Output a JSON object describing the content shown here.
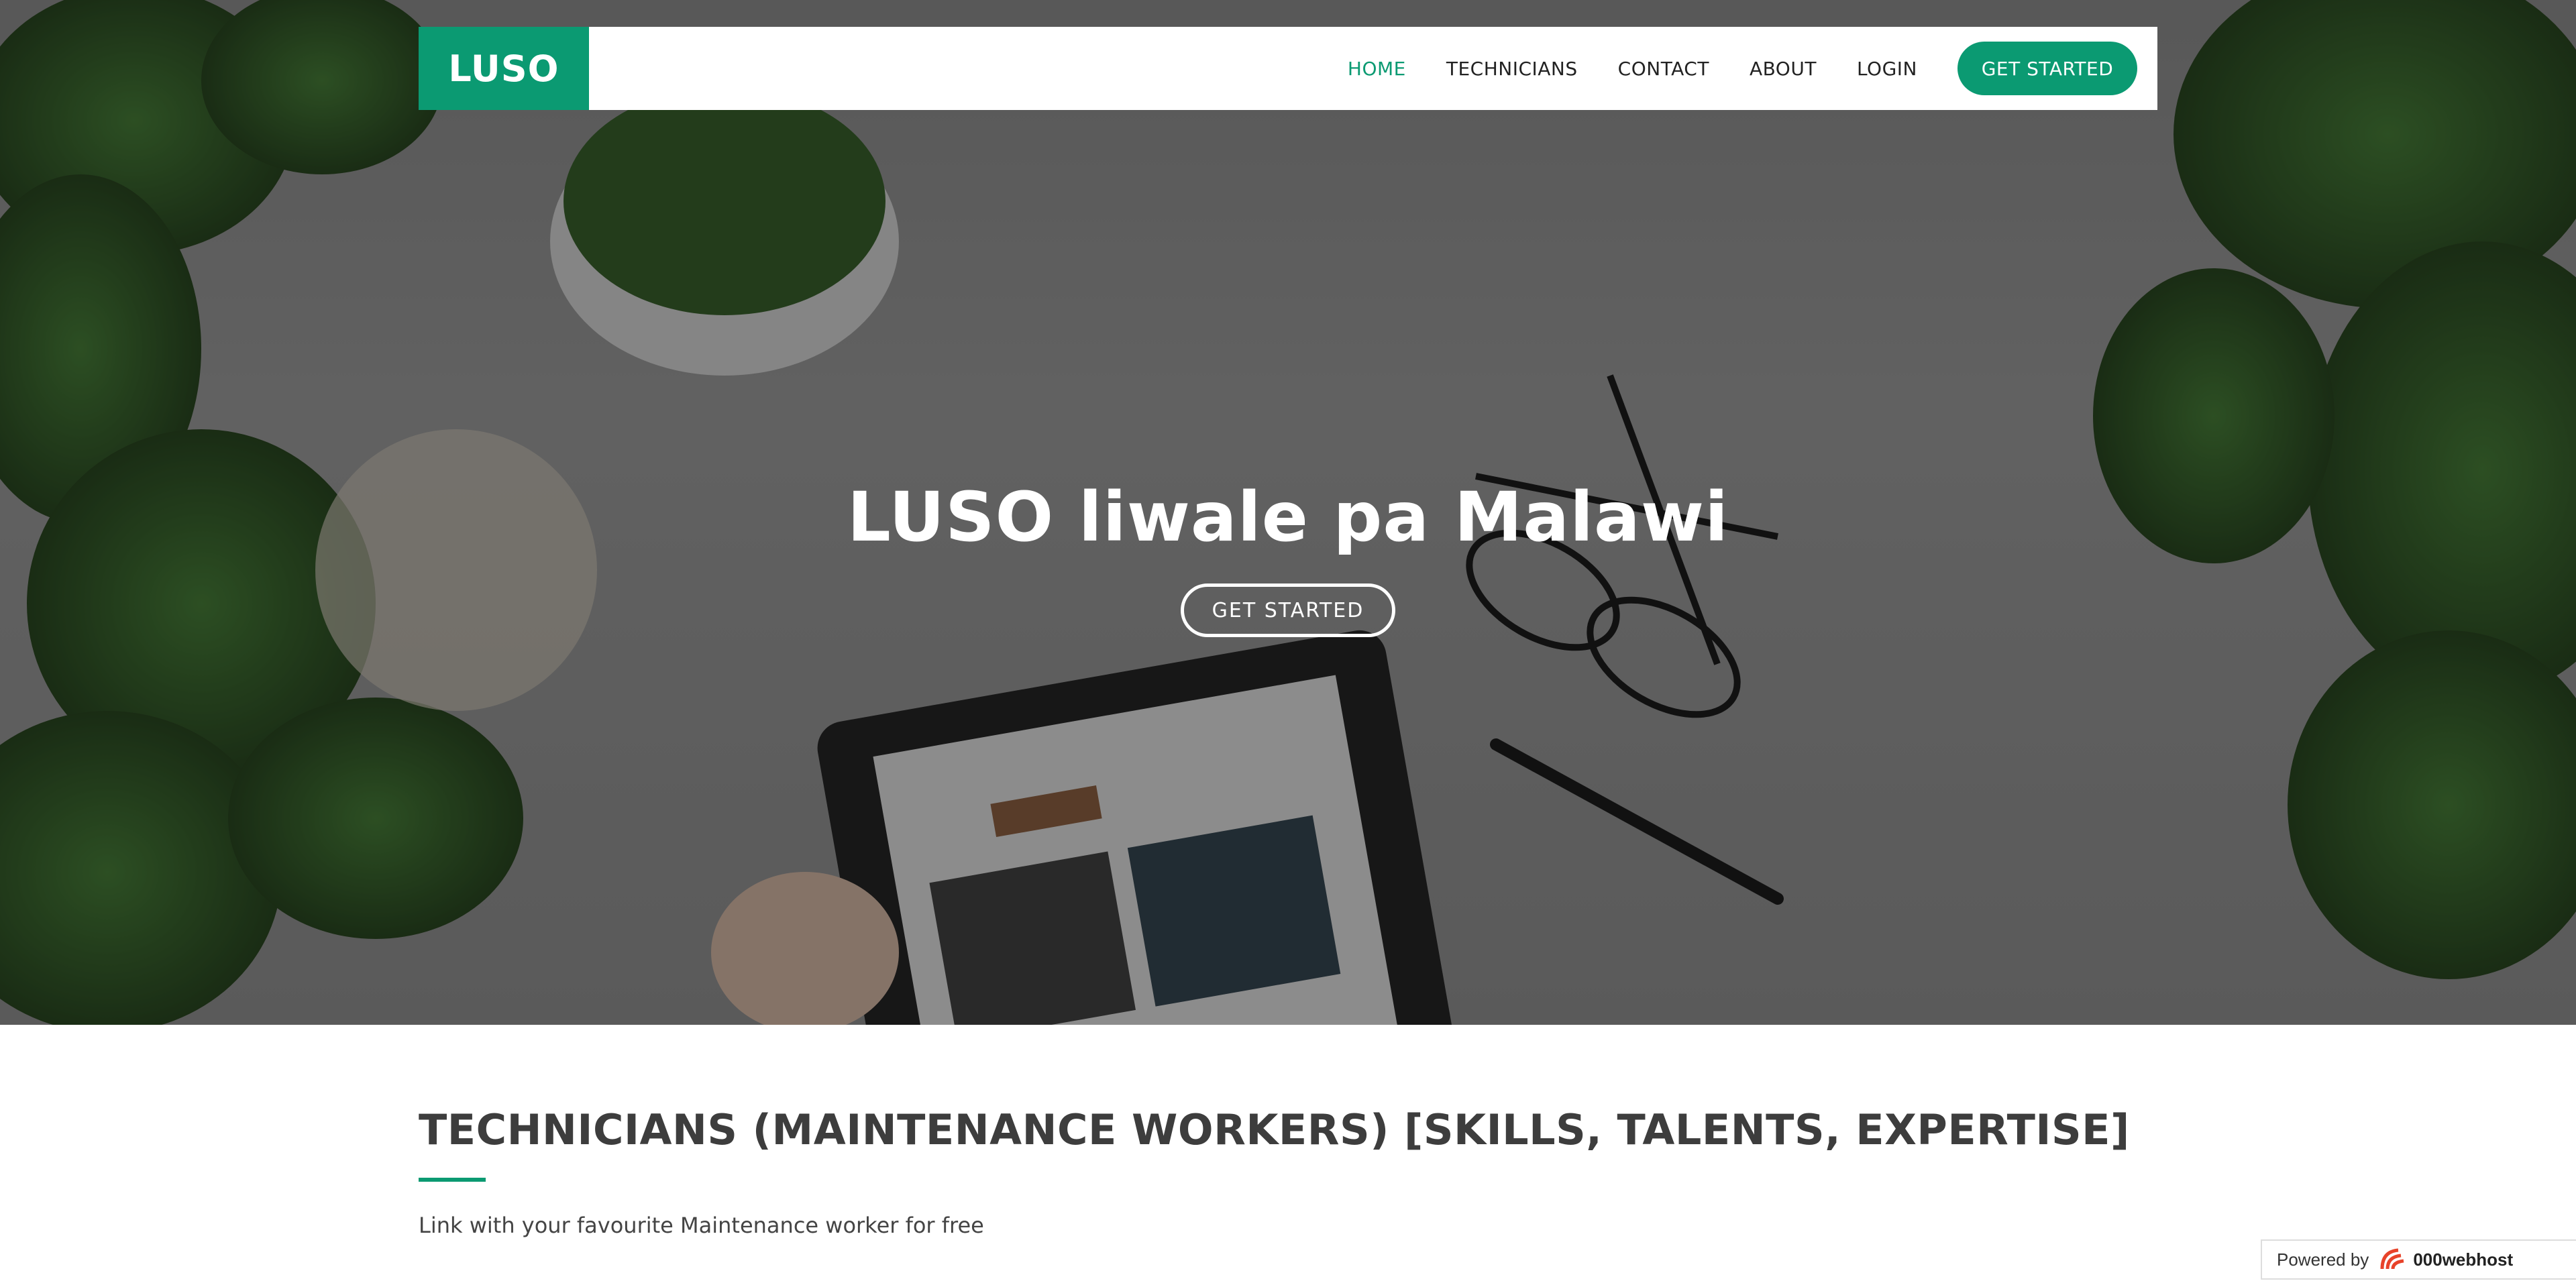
{
  "brand": {
    "logo": "LUSO",
    "accent_color": "#0b9a72"
  },
  "nav": {
    "items": [
      {
        "label": "HOME",
        "active": true
      },
      {
        "label": "TECHNICIANS",
        "active": false
      },
      {
        "label": "CONTACT",
        "active": false
      },
      {
        "label": "ABOUT",
        "active": false
      },
      {
        "label": "LOGIN",
        "active": false
      }
    ],
    "cta": "GET STARTED"
  },
  "hero": {
    "title": "LUSO liwale pa Malawi",
    "button": "GET STARTED",
    "background": "desk-with-plants-glasses-tablet-photo"
  },
  "section": {
    "title": "TECHNICIANS (MAINTENANCE WORKERS) [SKILLS, TALENTS, EXPERTISE]",
    "subtitle": "Link with your favourite Maintenance worker for free"
  },
  "footer_badge": {
    "prefix": "Powered by",
    "brand": "000webhost",
    "icon": "000webhost-logo-icon"
  }
}
